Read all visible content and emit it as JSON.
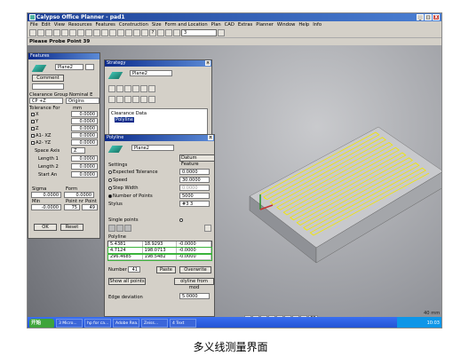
{
  "app": {
    "title": "Calypso Office Planner - pad1",
    "window_buttons": [
      "_",
      "□",
      "X"
    ]
  },
  "menu": [
    "File",
    "Edit",
    "View",
    "Resources",
    "Features",
    "Construction",
    "Size",
    "Form and Location",
    "Plan",
    "CAD",
    "Extras",
    "Planner",
    "Window",
    "Help",
    "Info"
  ],
  "toolbar": {
    "combo_value": "3"
  },
  "status_line": "Please Probe Point 39",
  "features_panel": {
    "title": "Features",
    "plane_name": "Plane2",
    "comment_button": "Comment",
    "clearance_group_label": "Clearance Group",
    "nominal_label": "Nominal E",
    "cp_value": "CP +Z",
    "origin_value": "Origins",
    "tolerance_label": "Tolerance For",
    "tolerance_label2": "mm",
    "tolerances": [
      {
        "label": "X",
        "value": "0.0000"
      },
      {
        "label": "Y",
        "value": "0.0000"
      },
      {
        "label": "Z",
        "value": "0.0000"
      },
      {
        "label": "A1- XZ",
        "value": "0.0000"
      },
      {
        "label": "A2- YZ",
        "value": "0.0000"
      }
    ],
    "space_axis_label": "Space Axis",
    "space_axis_value": "Z",
    "length1_label": "Length 1",
    "length1_value": "0.0000",
    "length2_label": "Length 2",
    "length2_value": "0.0000",
    "start_angle_label": "Start An",
    "start_angle_value": "0.0000",
    "sigma_label": "Sigma",
    "form_label": "Form",
    "sigma_value": "0.0000",
    "form_value": "0.0000",
    "min_label": "Min",
    "point_nr_label": "Point nr",
    "point_label": "Point",
    "min_value": "-0.0000",
    "point_nr_value": "75",
    "point_value": "49",
    "ok_button": "OK",
    "reset_button": "Reset"
  },
  "strategy_panel": {
    "title": "Strategy",
    "plane_name": "Plane2",
    "clearance_data": "Clearance Data",
    "polyline_item": "Polyline"
  },
  "polyline_dialog": {
    "title": "Polyline",
    "plane_name": "Plane2",
    "datum_button": "Datum Feature",
    "settings_label": "Settings",
    "options": [
      {
        "label": "Expected Tolerance",
        "value": "0.0000",
        "selected": false
      },
      {
        "label": "Speed",
        "value": "30.0000",
        "selected": false
      },
      {
        "label": "Step Width",
        "value": "0.0000",
        "selected": false
      },
      {
        "label": "Number of Points",
        "value": "5000",
        "selected": true
      }
    ],
    "stylus_label": "Stylus",
    "stylus_value": "#3 3",
    "single_points_label": "Single points",
    "polyline_label": "Polyline",
    "table_rows": [
      [
        "5.4381",
        "18.9293",
        "-0.0000"
      ],
      [
        "4.7124",
        "198.0713",
        "-0.0000"
      ],
      [
        "296.4685",
        "198.5482",
        "-0.0000"
      ]
    ],
    "number_label": "Number",
    "number_value": "41",
    "paste_button": "Paste",
    "overwrite_button": "Overwrite",
    "show_all_points_button": "Show all points",
    "polyline_from_model_button": "olyline from mod",
    "edge_deviation_label": "Edge deviation",
    "edge_deviation_value": "5.0000"
  },
  "view_toolbar": {
    "fr_label": "FR",
    "scale_label": "40 mm"
  },
  "taskbar": {
    "start_label": "开始",
    "tasks": [
      "3 Micro...",
      "hp for ca...",
      "Adobe Rea...",
      "Zeiss...",
      "4 Text"
    ],
    "clock": "10:03"
  },
  "caption": "多义线测量界面",
  "colors": {
    "title_bar": "#1c3f95",
    "polyline": "#f2e600",
    "highlight_rows": "#3bb33b",
    "taskbar": "#2b5ce0"
  }
}
